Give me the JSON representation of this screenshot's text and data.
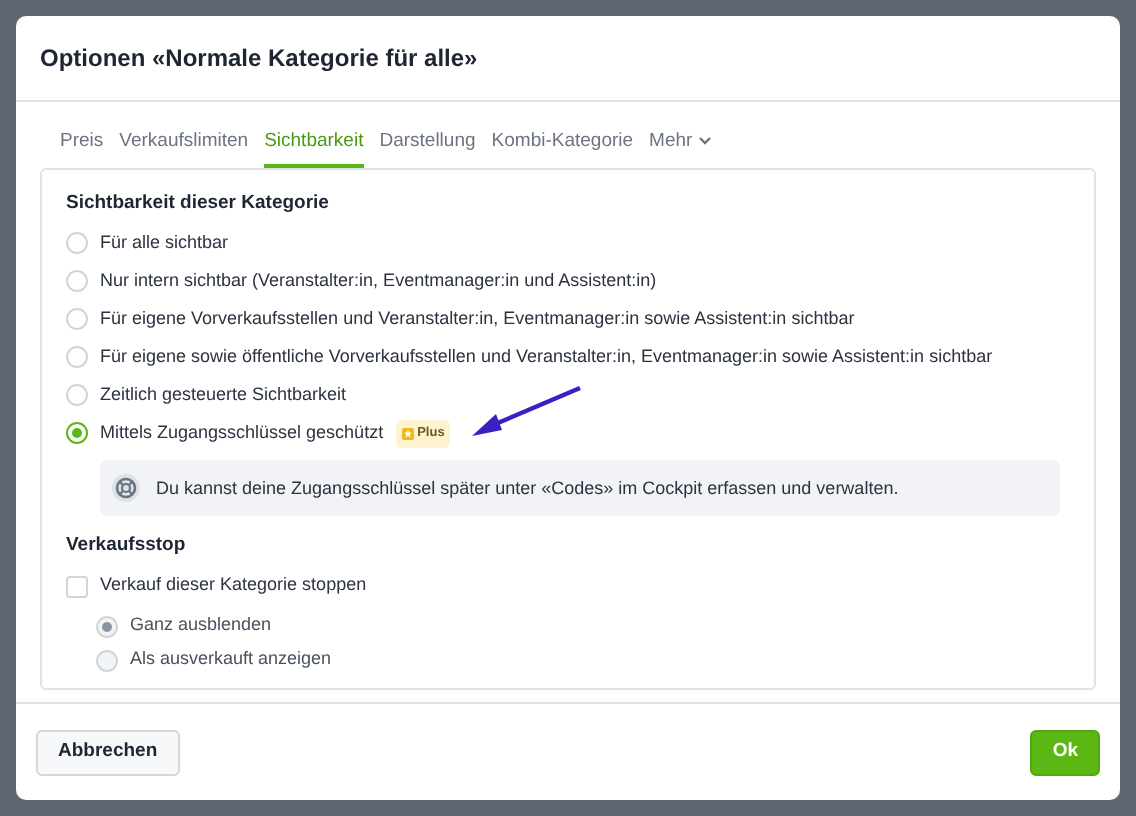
{
  "dialog": {
    "title": "Optionen «Normale Kategorie für alle»"
  },
  "tabs": [
    {
      "label": "Preis",
      "selected": false
    },
    {
      "label": "Verkaufslimiten",
      "selected": false
    },
    {
      "label": "Sichtbarkeit",
      "selected": true
    },
    {
      "label": "Darstellung",
      "selected": false
    },
    {
      "label": "Kombi-Kategorie",
      "selected": false
    },
    {
      "label": "Mehr",
      "selected": false,
      "kind": "dropdown"
    }
  ],
  "visibility": {
    "heading": "Sichtbarkeit dieser Kategorie",
    "options": [
      {
        "label": "Für alle sichtbar",
        "selected": false
      },
      {
        "label": "Nur intern sichtbar (Veranstalter:in, Eventmanager:in und Assistent:in)",
        "selected": false
      },
      {
        "label": "Für eigene Vorverkaufsstellen und Veranstalter:in, Eventmanager:in sowie Assistent:in sichtbar",
        "selected": false
      },
      {
        "label": "Für eigene sowie öffentliche Vorverkaufsstellen und Veranstalter:in, Eventmanager:in sowie Assistent:in sichtbar",
        "selected": false
      },
      {
        "label": "Zeitlich gesteuerte Sichtbarkeit",
        "selected": false
      },
      {
        "label": "Mittels Zugangsschlüssel geschützt",
        "selected": true,
        "badge": "Plus"
      }
    ],
    "info": "Du kannst deine Zugangsschlüssel später unter «Codes» im Cockpit erfassen und verwalten."
  },
  "sales_stop": {
    "heading": "Verkaufsstop",
    "checkbox": {
      "label": "Verkauf dieser Kategorie stoppen",
      "checked": false
    },
    "options": [
      {
        "label": "Ganz ausblenden",
        "selected": true,
        "disabled": true
      },
      {
        "label": "Als ausverkauft anzeigen",
        "selected": false,
        "disabled": true
      }
    ]
  },
  "buttons": [
    {
      "label": "Abbrechen",
      "kind": "secondary"
    },
    {
      "label": "Ok",
      "kind": "primary"
    }
  ]
}
